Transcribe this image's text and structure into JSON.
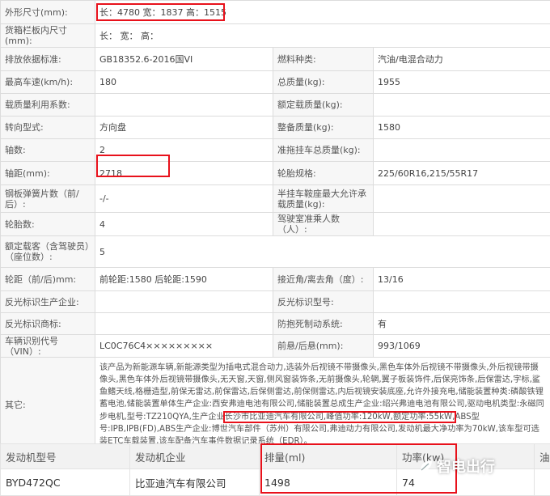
{
  "spec": {
    "outer_dim_label": "外形尺寸(mm):",
    "outer_dim_value": "长：4780 宽：1837 高：1515",
    "cargo_dim_label": "货箱栏板内尺寸(mm):",
    "cargo_dim_value": "长： 宽： 高：",
    "emission_label": "排放依据标准:",
    "emission_value": "GB18352.6-2016国VI",
    "fuel_label": "燃料种类:",
    "fuel_value": "汽油/电混合动力",
    "speed_label": "最高车速(km/h):",
    "speed_value": "180",
    "total_mass_label": "总质量(kg):",
    "total_mass_value": "1955",
    "load_util_label": "载质量利用系数:",
    "load_util_value": "",
    "rated_load_label": "额定载质量(kg):",
    "rated_load_value": "",
    "steering_label": "转向型式:",
    "steering_value": "方向盘",
    "curb_mass_label": "整备质量(kg):",
    "curb_mass_value": "1580",
    "axles_label": "轴数:",
    "axles_value": "2",
    "trailer_mass_label": "准拖挂车总质量(kg):",
    "trailer_mass_value": "",
    "wheelbase_label": "轴距(mm):",
    "wheelbase_value": "2718",
    "tire_spec_label": "轮胎规格:",
    "tire_spec_value": "225/60R16,215/55R17",
    "spring_label": "钢板弹簧片数（前/后）:",
    "spring_value": "-/-",
    "saddle_label": "半挂车鞍座最大允许承载质量(kg):",
    "saddle_value": "",
    "tire_count_label": "轮胎数:",
    "tire_count_value": "4",
    "cab_seats_label": "驾驶室准乘人数（人）:",
    "cab_seats_value": "",
    "passengers_label": "额定载客（含驾驶员）（座位数）:",
    "passengers_value": "5",
    "track_label": "轮距（前/后)mm:",
    "track_value": "前轮距:1580 后轮距:1590",
    "approach_label": "接近角/离去角（度）:",
    "approach_value": "13/16",
    "reflector_maker_label": "反光标识生产企业:",
    "reflector_maker_value": "",
    "reflector_model_label": "反光标识型号:",
    "reflector_model_value": "",
    "reflector_brand_label": "反光标识商标:",
    "reflector_brand_value": "",
    "abs_label": "防抱死制动系统:",
    "abs_value": "有",
    "vin_label": "车辆识别代号（VIN）:",
    "vin_value": "LC0C76C4×××××××××",
    "overhang_label": "前悬/后悬(mm):",
    "overhang_value": "993/1069",
    "other_label": "其它:",
    "other_part1": "该产品为新能源车辆,新能源类型为插电式混合动力,选装外后视镜不带摄像头,黑色车体外后视镜不带摄像头,外后视镜带摄像头,黑色车体外后视镜带摄像头,无天窗,天窗,侧风窗装饰条,无前摄像头,轮辋,翼子板装饰件,后保亮饰条,后保雷达,字标,鲨鱼鳍天线,格栅造型,前保无雷达,前保雷达,后保侧雷达,前保侧雷达,内后视镜安装底座,允许外接充电,储能装置种类:磷酸铁锂蓄电池,储能装置单体生产企业:西安弗迪电池有限公司,储能装置总成生产企业:绍兴弗迪电池有限公司,驱动电机类型:永磁同步电机,型号:TZ210QYA,生产企业",
    "other_highlight": "长沙市比亚迪汽车有限公司,峰值功率:120kW,额定功率:55kW,",
    "other_part2": "ABS型号:IPB,IPB(FD),ABS生产企业:博世汽车部件（苏州）有限公司,弗迪动力有限公司,发动机最大净功率为70kW,该车型可选装ETC车载装置,该车配备汽车事件数据记录系统（EDR）。"
  },
  "engine": {
    "headers": [
      "发动机型号",
      "发动机企业",
      "排量(ml)",
      "功率(kw)",
      "油耗"
    ],
    "row": [
      "BYD472QC",
      "比亚迪汽车有限公司",
      "1498",
      "74",
      ""
    ]
  },
  "watermark": {
    "text": "智电出行",
    "icon": "leaf-logo-icon"
  },
  "colors": {
    "highlight": "#e8111b"
  }
}
